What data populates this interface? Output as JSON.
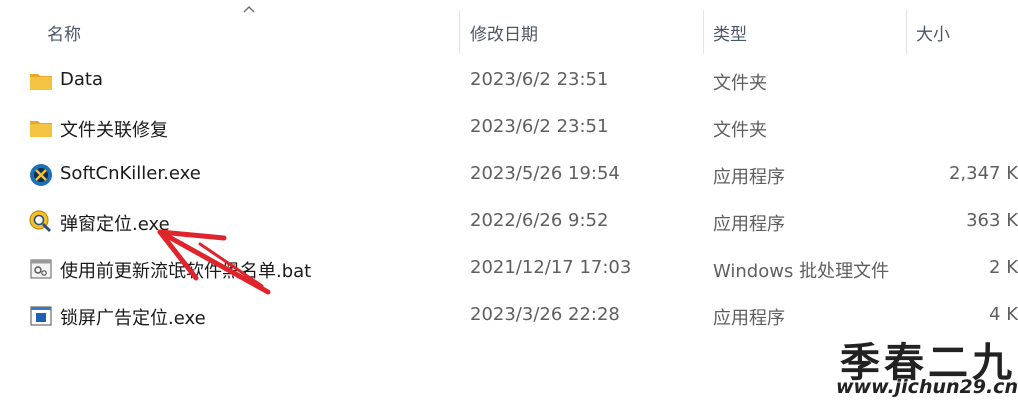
{
  "columns": {
    "name": "名称",
    "modified": "修改日期",
    "type": "类型",
    "size": "大小"
  },
  "files": [
    {
      "name": "Data",
      "modified": "2023/6/2 23:51",
      "type": "文件夹",
      "size": "",
      "icon": "folder-icon"
    },
    {
      "name": "文件关联修复",
      "modified": "2023/6/2 23:51",
      "type": "文件夹",
      "size": "",
      "icon": "folder-icon"
    },
    {
      "name": "SoftCnKiller.exe",
      "modified": "2023/5/26 19:54",
      "type": "应用程序",
      "size": "2,347 K",
      "icon": "softcnkiller-app-icon"
    },
    {
      "name": "弹窗定位.exe",
      "modified": "2022/6/26 9:52",
      "type": "应用程序",
      "size": "363 K",
      "icon": "popup-locator-app-icon"
    },
    {
      "name": "使用前更新流氓软件黑名单.bat",
      "modified": "2021/12/17 17:03",
      "type": "Windows 批处理文件",
      "size": "2 K",
      "icon": "batch-file-icon"
    },
    {
      "name": "锁屏广告定位.exe",
      "modified": "2023/3/26 22:28",
      "type": "应用程序",
      "size": "4 K",
      "icon": "lockscreen-app-icon"
    }
  ],
  "watermark": {
    "text": "季春二九",
    "url": "www.jichun29.cn"
  },
  "colors": {
    "folder": "#f5c342",
    "annotation_arrow": "#e0242b"
  }
}
